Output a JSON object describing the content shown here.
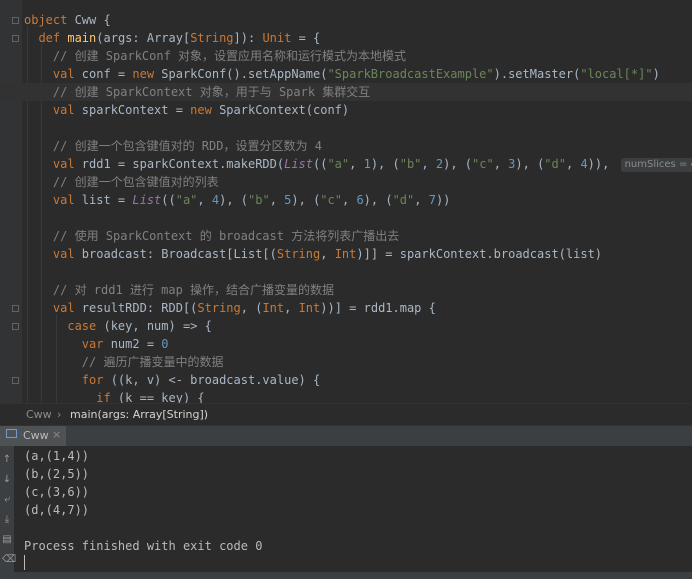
{
  "editor": {
    "lines": [
      {
        "tokens": [
          {
            "t": "object ",
            "c": "kw"
          },
          {
            "t": "Cww ",
            "c": ""
          },
          {
            "t": "{",
            "c": ""
          }
        ]
      },
      {
        "tokens": [
          {
            "t": "  def ",
            "c": "kw"
          },
          {
            "t": "main",
            "c": "fn"
          },
          {
            "t": "(args: Array[",
            "c": ""
          },
          {
            "t": "String",
            "c": "kw"
          },
          {
            "t": "]): ",
            "c": ""
          },
          {
            "t": "Unit",
            "c": "kw"
          },
          {
            "t": " = {",
            "c": ""
          }
        ]
      },
      {
        "tokens": [
          {
            "t": "    // 创建 SparkConf 对象，设置应用名称和运行模式为本地模式",
            "c": "cm"
          }
        ]
      },
      {
        "tokens": [
          {
            "t": "    val ",
            "c": "kw"
          },
          {
            "t": "conf = ",
            "c": ""
          },
          {
            "t": "new ",
            "c": "kw"
          },
          {
            "t": "SparkConf().setAppName(",
            "c": ""
          },
          {
            "t": "\"SparkBroadcastExample\"",
            "c": "str"
          },
          {
            "t": ").setMaster(",
            "c": ""
          },
          {
            "t": "\"local[*]\"",
            "c": "str"
          },
          {
            "t": ")",
            "c": ""
          }
        ]
      },
      {
        "tokens": [
          {
            "t": "    // 创建 SparkContext 对象，用于与 Spark 集群交互",
            "c": "cm"
          }
        ]
      },
      {
        "tokens": [
          {
            "t": "    val ",
            "c": "kw"
          },
          {
            "t": "sparkContext = ",
            "c": ""
          },
          {
            "t": "new ",
            "c": "kw"
          },
          {
            "t": "SparkContext(conf)",
            "c": ""
          }
        ]
      },
      {
        "tokens": []
      },
      {
        "tokens": [
          {
            "t": "    // 创建一个包含键值对的 RDD，设置分区数为 4",
            "c": "cm"
          }
        ]
      },
      {
        "tokens": [
          {
            "t": "    val ",
            "c": "kw"
          },
          {
            "t": "rdd1 = sparkContext.makeRDD(",
            "c": ""
          },
          {
            "t": "List",
            "c": "param"
          },
          {
            "t": "((",
            "c": ""
          },
          {
            "t": "\"a\"",
            "c": "str"
          },
          {
            "t": ", ",
            "c": ""
          },
          {
            "t": "1",
            "c": "num"
          },
          {
            "t": "), (",
            "c": ""
          },
          {
            "t": "\"b\"",
            "c": "str"
          },
          {
            "t": ", ",
            "c": ""
          },
          {
            "t": "2",
            "c": "num"
          },
          {
            "t": "), (",
            "c": ""
          },
          {
            "t": "\"c\"",
            "c": "str"
          },
          {
            "t": ", ",
            "c": ""
          },
          {
            "t": "3",
            "c": "num"
          },
          {
            "t": "), (",
            "c": ""
          },
          {
            "t": "\"d\"",
            "c": "str"
          },
          {
            "t": ", ",
            "c": ""
          },
          {
            "t": "4",
            "c": "num"
          },
          {
            "t": ")), ",
            "c": ""
          },
          {
            "t": "numSlices = 4",
            "c": "hint"
          },
          {
            "t": ")",
            "c": ""
          }
        ]
      },
      {
        "tokens": [
          {
            "t": "    // 创建一个包含键值对的列表",
            "c": "cm"
          }
        ]
      },
      {
        "tokens": [
          {
            "t": "    val ",
            "c": "kw"
          },
          {
            "t": "list = ",
            "c": ""
          },
          {
            "t": "List",
            "c": "param"
          },
          {
            "t": "((",
            "c": ""
          },
          {
            "t": "\"a\"",
            "c": "str"
          },
          {
            "t": ", ",
            "c": ""
          },
          {
            "t": "4",
            "c": "num"
          },
          {
            "t": "), (",
            "c": ""
          },
          {
            "t": "\"b\"",
            "c": "str"
          },
          {
            "t": ", ",
            "c": ""
          },
          {
            "t": "5",
            "c": "num"
          },
          {
            "t": "), (",
            "c": ""
          },
          {
            "t": "\"c\"",
            "c": "str"
          },
          {
            "t": ", ",
            "c": ""
          },
          {
            "t": "6",
            "c": "num"
          },
          {
            "t": "), (",
            "c": ""
          },
          {
            "t": "\"d\"",
            "c": "str"
          },
          {
            "t": ", ",
            "c": ""
          },
          {
            "t": "7",
            "c": "num"
          },
          {
            "t": "))",
            "c": ""
          }
        ]
      },
      {
        "tokens": []
      },
      {
        "tokens": [
          {
            "t": "    // 使用 SparkContext 的 broadcast 方法将列表广播出去",
            "c": "cm"
          }
        ]
      },
      {
        "tokens": [
          {
            "t": "    val ",
            "c": "kw"
          },
          {
            "t": "broadcast: Broadcast[List[(",
            "c": ""
          },
          {
            "t": "String",
            "c": "kw"
          },
          {
            "t": ", ",
            "c": ""
          },
          {
            "t": "Int",
            "c": "kw"
          },
          {
            "t": ")]] = sparkContext.broadcast(list)",
            "c": ""
          }
        ]
      },
      {
        "tokens": []
      },
      {
        "tokens": [
          {
            "t": "    // 对 rdd1 进行 map 操作，结合广播变量的数据",
            "c": "cm"
          }
        ]
      },
      {
        "tokens": [
          {
            "t": "    val ",
            "c": "kw"
          },
          {
            "t": "resultRDD: RDD[(",
            "c": ""
          },
          {
            "t": "String",
            "c": "kw"
          },
          {
            "t": ", (",
            "c": ""
          },
          {
            "t": "Int",
            "c": "kw"
          },
          {
            "t": ", ",
            "c": ""
          },
          {
            "t": "Int",
            "c": "kw"
          },
          {
            "t": "))] = rdd1.map {",
            "c": ""
          }
        ]
      },
      {
        "tokens": [
          {
            "t": "      case ",
            "c": "kw"
          },
          {
            "t": "(key, num) => {",
            "c": ""
          }
        ]
      },
      {
        "tokens": [
          {
            "t": "        var ",
            "c": "kw"
          },
          {
            "t": "num2 = ",
            "c": ""
          },
          {
            "t": "0",
            "c": "num"
          }
        ]
      },
      {
        "tokens": [
          {
            "t": "        // 遍历广播变量中的数据",
            "c": "cm"
          }
        ]
      },
      {
        "tokens": [
          {
            "t": "        for ",
            "c": "kw"
          },
          {
            "t": "((k, v) <- broadcast.value) {",
            "c": ""
          }
        ]
      },
      {
        "tokens": [
          {
            "t": "          if ",
            "c": "kw"
          },
          {
            "t": "(k == key) {",
            "c": ""
          }
        ]
      }
    ]
  },
  "breadcrumb": {
    "object": "Cww",
    "method": "main(args: Array[String])"
  },
  "run": {
    "tab_label": "Cww",
    "output": [
      "(a,(1,4))",
      "(b,(2,5))",
      "(c,(3,6))",
      "(d,(4,7))",
      "",
      "Process finished with exit code 0"
    ]
  }
}
